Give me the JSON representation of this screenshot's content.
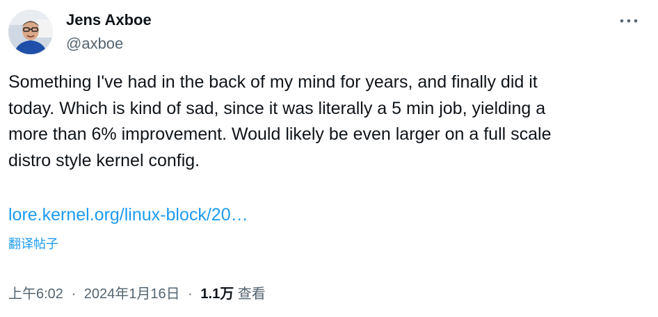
{
  "author": {
    "display_name": "Jens Axboe",
    "handle": "@axboe"
  },
  "menu": {
    "icon": "more-horizontal-icon"
  },
  "tweet": {
    "text": "Something I've had in the back of my mind for years, and finally did it\ntoday. Which is kind of sad, since it was literally a 5 min job, yielding a\nmore than 6% improvement. Would likely be even larger on a full scale\ndistro style kernel config.",
    "link_text": "lore.kernel.org/linux-block/20…",
    "translate_label": "翻译帖子"
  },
  "meta": {
    "time": "上午6:02",
    "separator": "·",
    "date": "2024年1月16日",
    "views_count": "1.1万",
    "views_label": "查看"
  },
  "colors": {
    "link": "#1d9bf0",
    "secondary_text": "#536471",
    "primary_text": "#0f1419"
  }
}
